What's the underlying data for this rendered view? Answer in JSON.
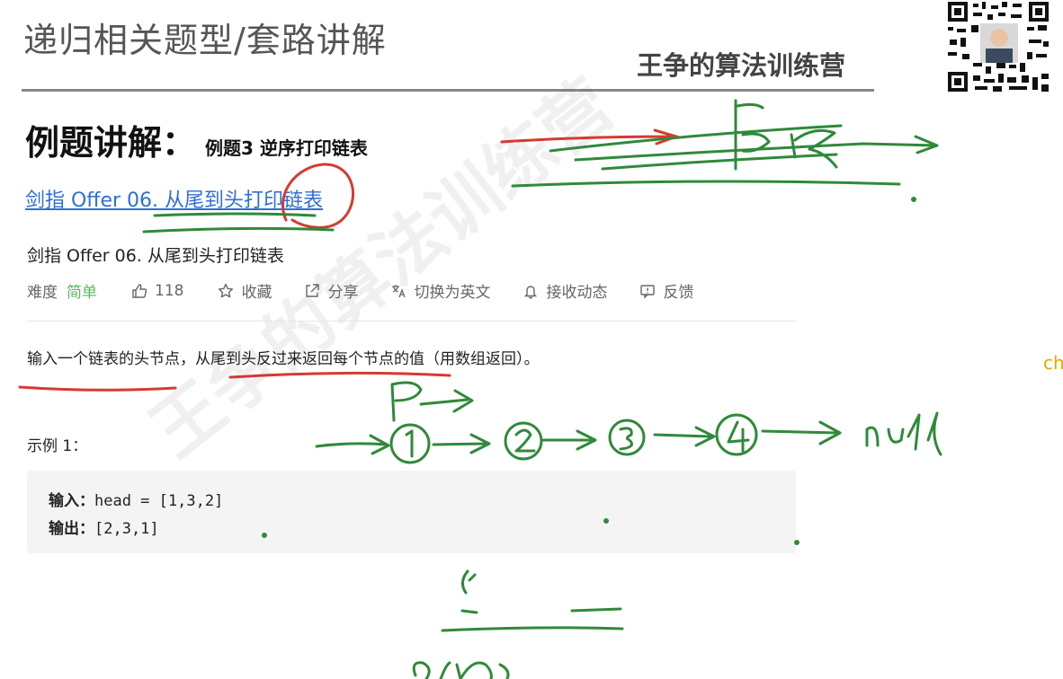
{
  "slide": {
    "title": "递归相关题型/套路讲解",
    "brand": "王争的算法训练营",
    "watermark": "王争的算法训练营"
  },
  "heading": {
    "main": "例题讲解：",
    "sub": "例题3 逆序打印链表"
  },
  "problem": {
    "link_text": "剑指 Offer 06. 从尾到头打印链表",
    "title": "剑指 Offer 06. 从尾到头打印链表",
    "meta": {
      "difficulty_label": "难度",
      "difficulty_value": "简单",
      "likes": "118",
      "favorite_label": "收藏",
      "share_label": "分享",
      "switch_lang_label": "切换为英文",
      "subscribe_label": "接收动态",
      "feedback_label": "反馈"
    },
    "description": "输入一个链表的头节点，从尾到头反过来返回每个节点的值（用数组返回）。",
    "example_label": "示例 1：",
    "example": {
      "input_label": "输入：",
      "input_value": "head = [1,3,2]",
      "output_label": "输出：",
      "output_value": "[2,3,1]"
    }
  },
  "side_text": "ch",
  "annotations": {
    "red_color": "#d63a2f",
    "green_color": "#2f8a3a",
    "nodes": [
      "1",
      "2",
      "3",
      "4"
    ],
    "pointer_label": "P",
    "null_label": "null",
    "bottom_label": "O(n)"
  }
}
